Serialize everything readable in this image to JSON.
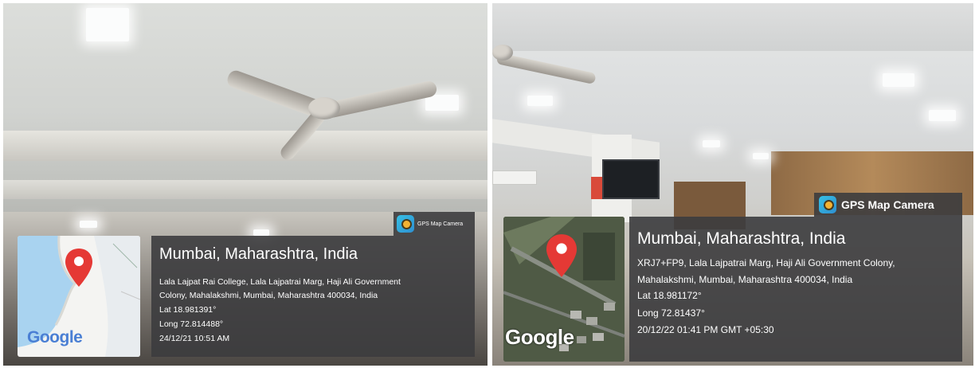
{
  "left_photo": {
    "badge": {
      "app_name": "GPS Map Camera",
      "icon": "gps-map-camera-icon"
    },
    "location_title": "Mumbai, Maharashtra, India",
    "address_lines": [
      "Lala Lajpat Rai College, Lala Lajpatrai Marg, Haji Ali Government",
      "Colony, Mahalakshmi, Mumbai, Maharashtra 400034, India"
    ],
    "lat": "Lat 18.981391°",
    "long": "Long 72.814488°",
    "datetime": "24/12/21 10:51 AM",
    "map_logo": "Google"
  },
  "right_photo": {
    "badge": {
      "app_name": "GPS Map Camera",
      "icon": "gps-map-camera-icon"
    },
    "location_title": "Mumbai, Maharashtra, India",
    "address_lines": [
      "XRJ7+FP9, Lala Lajpatrai Marg, Haji Ali Government Colony,",
      "Mahalakshmi, Mumbai, Maharashtra 400034, India"
    ],
    "lat": "Lat 18.981172°",
    "long": "Long 72.81437°",
    "datetime": "20/12/22 01:41 PM GMT +05:30",
    "map_logo": "Google"
  },
  "colors": {
    "overlay": "#3c3c3e",
    "pin": "#e53935",
    "map_water": "#a9d3f0",
    "map_satellite": "#4f5a45"
  }
}
